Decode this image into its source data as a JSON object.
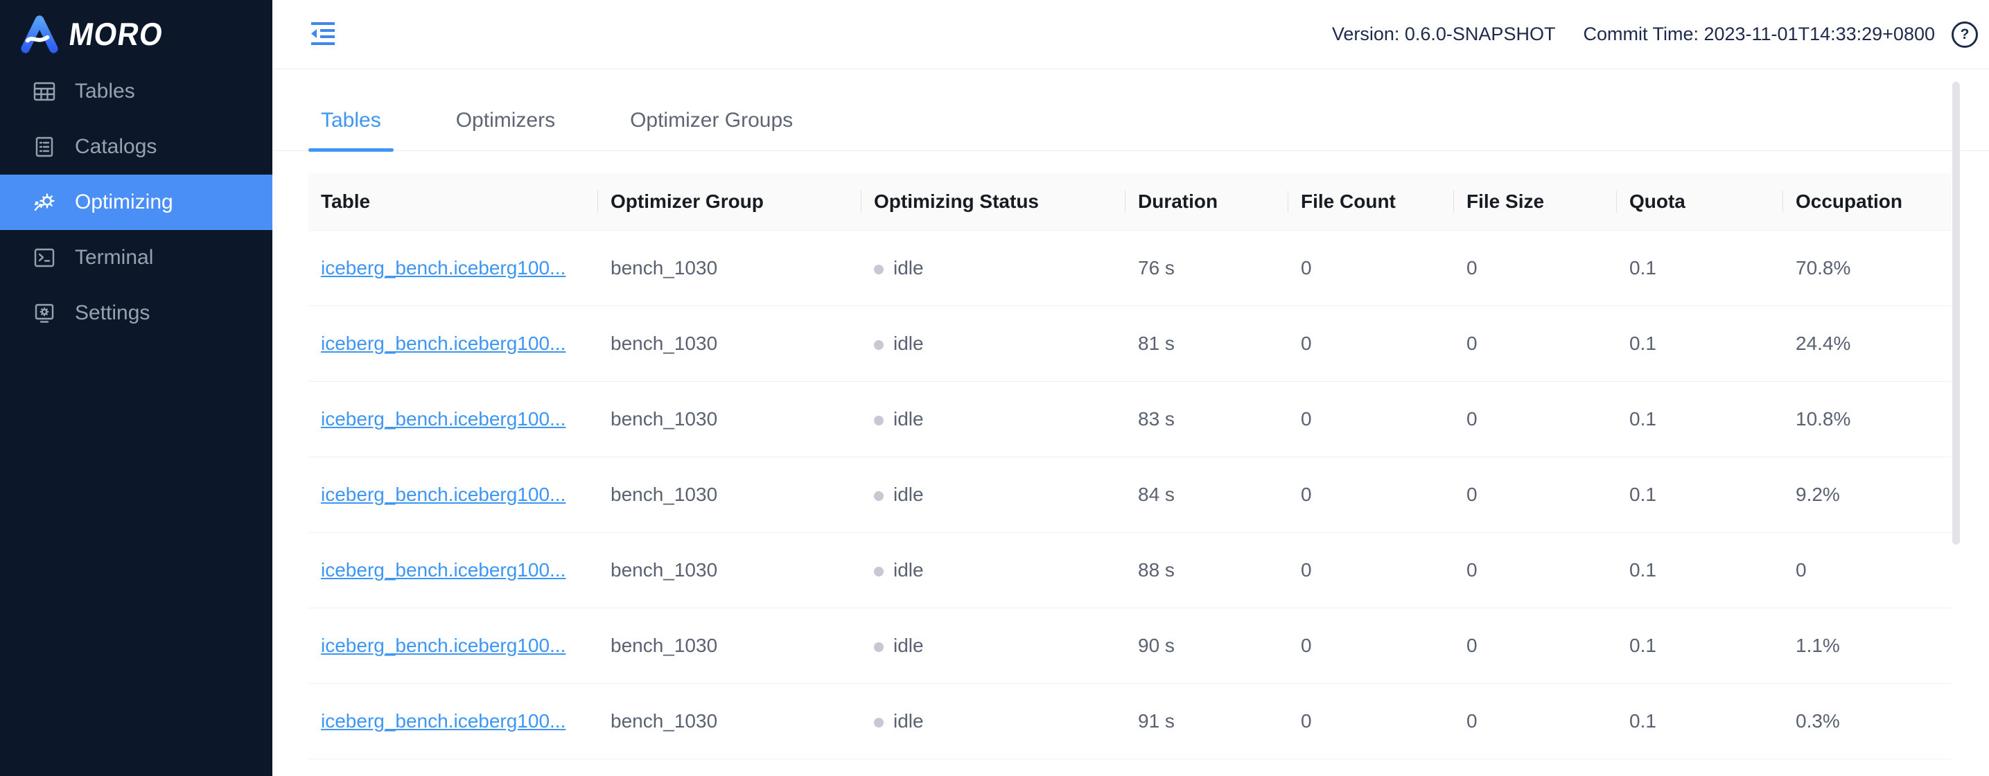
{
  "colors": {
    "accent": "#3d96f4",
    "link": "#3d96f4",
    "sidebar_bg": "#0c1829",
    "selected_bg": "#4a8ff5",
    "topbar_text": "#1d2a4a",
    "status_dot": "#c6c9d2"
  },
  "sidebar": {
    "logo_text": "MORO",
    "items": [
      {
        "id": "tables",
        "label": "Tables",
        "icon": "tables-icon",
        "active": false
      },
      {
        "id": "catalogs",
        "label": "Catalogs",
        "icon": "catalogs-icon",
        "active": false
      },
      {
        "id": "optimizing",
        "label": "Optimizing",
        "icon": "optimizing-icon",
        "active": true
      },
      {
        "id": "terminal",
        "label": "Terminal",
        "icon": "terminal-icon",
        "active": false
      },
      {
        "id": "settings",
        "label": "Settings",
        "icon": "settings-icon",
        "active": false
      }
    ]
  },
  "topbar": {
    "version": "Version: 0.6.0-SNAPSHOT",
    "commit_time": "Commit Time: 2023-11-01T14:33:29+0800",
    "help_glyph": "?"
  },
  "tabs": [
    {
      "id": "tables",
      "label": "Tables",
      "active": true
    },
    {
      "id": "optimizers",
      "label": "Optimizers",
      "active": false
    },
    {
      "id": "optimizer-groups",
      "label": "Optimizer Groups",
      "active": false
    }
  ],
  "table": {
    "columns": [
      "Table",
      "Optimizer Group",
      "Optimizing Status",
      "Duration",
      "File Count",
      "File Size",
      "Quota",
      "Occupation"
    ],
    "rows": [
      {
        "table": "iceberg_bench.iceberg100...",
        "optimizer_group": "bench_1030",
        "optimizing_status": "idle",
        "duration": "76 s",
        "file_count": "0",
        "file_size": "0",
        "quota": "0.1",
        "occupation": "70.8%"
      },
      {
        "table": "iceberg_bench.iceberg100...",
        "optimizer_group": "bench_1030",
        "optimizing_status": "idle",
        "duration": "81 s",
        "file_count": "0",
        "file_size": "0",
        "quota": "0.1",
        "occupation": "24.4%"
      },
      {
        "table": "iceberg_bench.iceberg100...",
        "optimizer_group": "bench_1030",
        "optimizing_status": "idle",
        "duration": "83 s",
        "file_count": "0",
        "file_size": "0",
        "quota": "0.1",
        "occupation": "10.8%"
      },
      {
        "table": "iceberg_bench.iceberg100...",
        "optimizer_group": "bench_1030",
        "optimizing_status": "idle",
        "duration": "84 s",
        "file_count": "0",
        "file_size": "0",
        "quota": "0.1",
        "occupation": "9.2%"
      },
      {
        "table": "iceberg_bench.iceberg100...",
        "optimizer_group": "bench_1030",
        "optimizing_status": "idle",
        "duration": "88 s",
        "file_count": "0",
        "file_size": "0",
        "quota": "0.1",
        "occupation": "0"
      },
      {
        "table": "iceberg_bench.iceberg100...",
        "optimizer_group": "bench_1030",
        "optimizing_status": "idle",
        "duration": "90 s",
        "file_count": "0",
        "file_size": "0",
        "quota": "0.1",
        "occupation": "1.1%"
      },
      {
        "table": "iceberg_bench.iceberg100...",
        "optimizer_group": "bench_1030",
        "optimizing_status": "idle",
        "duration": "91 s",
        "file_count": "0",
        "file_size": "0",
        "quota": "0.1",
        "occupation": "0.3%"
      }
    ]
  }
}
